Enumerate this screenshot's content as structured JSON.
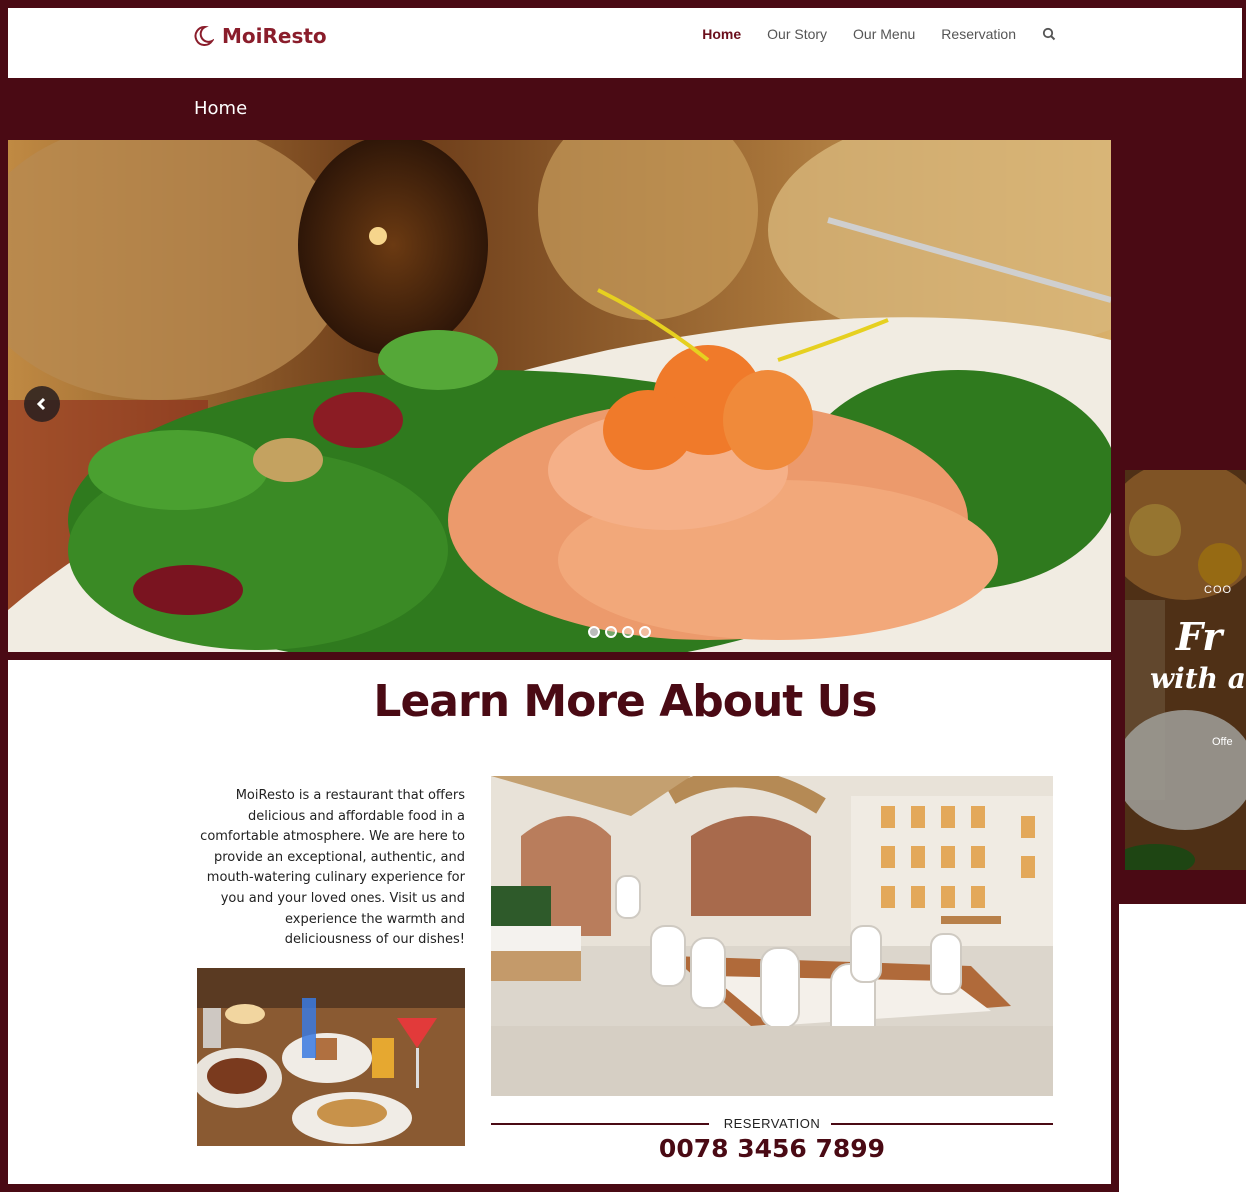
{
  "site": {
    "brand": "MoiResto",
    "nav": [
      "Home",
      "Our Story",
      "Our Menu",
      "Reservation"
    ],
    "active_nav": "Home",
    "breadcrumb": "Home"
  },
  "hero": {
    "slide_count": 4,
    "active_slide": 1
  },
  "about": {
    "title": "Learn More About Us",
    "description": "MoiResto is a restaurant that offers delicious and affordable food in a comfortable atmosphere. We are here to provide an exceptional, authentic, and mouth-watering culinary experience for you and your loved ones. Visit us and experience the warmth and deliciousness of our dishes!",
    "reservation_label": "RESERVATION",
    "reservation_phone": "0078 3456 7899"
  },
  "second_window": {
    "label_fragment": "COO",
    "headline_fragment": "Fr",
    "subline_fragment": "with a",
    "text_fragment": "Offe"
  },
  "colors": {
    "brand_dark": "#4a0a14",
    "brand_accent": "#8a1d2b"
  },
  "icons": {
    "logo": "crescent-moon-icon",
    "search": "search-icon",
    "prev": "chevron-left-icon"
  }
}
